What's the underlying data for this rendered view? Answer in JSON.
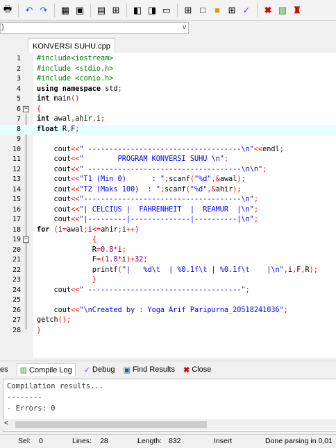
{
  "editor_tab": {
    "filename": "KONVERSI SUHU.cpp"
  },
  "combo": {
    "lead": ")",
    "arrow": "v"
  },
  "code_lines": [
    {
      "n": "1",
      "fold": "",
      "tokens": [
        {
          "c": "pp",
          "t": "#include<iostream>"
        }
      ]
    },
    {
      "n": "2",
      "fold": "",
      "tokens": [
        {
          "c": "pp",
          "t": "#include <stdio.h>"
        }
      ]
    },
    {
      "n": "3",
      "fold": "",
      "tokens": [
        {
          "c": "pp",
          "t": "#include <conio.h>"
        }
      ]
    },
    {
      "n": "4",
      "fold": "",
      "tokens": [
        {
          "c": "kw",
          "t": "using namespace "
        },
        {
          "c": "id",
          "t": "std"
        },
        {
          "c": "sym",
          "t": ";"
        }
      ]
    },
    {
      "n": "5",
      "fold": "",
      "tokens": [
        {
          "c": "kw",
          "t": "int "
        },
        {
          "c": "id",
          "t": "main"
        },
        {
          "c": "sym",
          "t": "()"
        }
      ]
    },
    {
      "n": "6",
      "fold": "⊟",
      "tokens": [
        {
          "c": "sym",
          "t": "{"
        }
      ]
    },
    {
      "n": "7",
      "fold": "",
      "tokens": [
        {
          "c": "kw",
          "t": "int "
        },
        {
          "c": "id",
          "t": "awal"
        },
        {
          "c": "sym",
          "t": ","
        },
        {
          "c": "id",
          "t": "ahir"
        },
        {
          "c": "sym",
          "t": ","
        },
        {
          "c": "id",
          "t": "i"
        },
        {
          "c": "sym",
          "t": ";"
        }
      ]
    },
    {
      "n": "8",
      "fold": "",
      "hl": true,
      "tokens": [
        {
          "c": "kw",
          "t": "float "
        },
        {
          "c": "id",
          "t": "R"
        },
        {
          "c": "sym",
          "t": ","
        },
        {
          "c": "id",
          "t": "F"
        },
        {
          "c": "sym",
          "t": ";"
        }
      ]
    },
    {
      "n": "9",
      "fold": "",
      "tokens": []
    },
    {
      "n": "10",
      "fold": "",
      "tokens": [
        {
          "c": "id",
          "t": "    cout"
        },
        {
          "c": "sym",
          "t": "<<"
        },
        {
          "c": "str",
          "t": "\" ------------------------------------\\n\""
        },
        {
          "c": "sym",
          "t": "<<"
        },
        {
          "c": "id",
          "t": "endl"
        },
        {
          "c": "sym",
          "t": ";"
        }
      ]
    },
    {
      "n": "11",
      "fold": "",
      "tokens": [
        {
          "c": "id",
          "t": "    cout"
        },
        {
          "c": "sym",
          "t": "<<"
        },
        {
          "c": "str",
          "t": "\"        PROGRAM KONVERSI SUHU \\n\""
        },
        {
          "c": "sym",
          "t": ";"
        }
      ]
    },
    {
      "n": "12",
      "fold": "",
      "tokens": [
        {
          "c": "id",
          "t": "    cout"
        },
        {
          "c": "sym",
          "t": "<<"
        },
        {
          "c": "str",
          "t": "\" ------------------------------------\\n\\n\""
        },
        {
          "c": "sym",
          "t": ";"
        }
      ]
    },
    {
      "n": "13",
      "fold": "",
      "tokens": [
        {
          "c": "id",
          "t": "    cout"
        },
        {
          "c": "sym",
          "t": "<<"
        },
        {
          "c": "str",
          "t": "\"T1 (Min 0)      : \""
        },
        {
          "c": "sym",
          "t": ";"
        },
        {
          "c": "id",
          "t": "scanf"
        },
        {
          "c": "sym",
          "t": "("
        },
        {
          "c": "str",
          "t": "\"%d\""
        },
        {
          "c": "sym",
          "t": ",&"
        },
        {
          "c": "id",
          "t": "awal"
        },
        {
          "c": "sym",
          "t": ");"
        }
      ]
    },
    {
      "n": "14",
      "fold": "",
      "tokens": [
        {
          "c": "id",
          "t": "    cout"
        },
        {
          "c": "sym",
          "t": "<<"
        },
        {
          "c": "str",
          "t": "\"T2 (Maks 100)  : \""
        },
        {
          "c": "sym",
          "t": ";"
        },
        {
          "c": "id",
          "t": "scanf"
        },
        {
          "c": "sym",
          "t": "("
        },
        {
          "c": "str",
          "t": "\"%d\""
        },
        {
          "c": "sym",
          "t": ",&"
        },
        {
          "c": "id",
          "t": "ahir"
        },
        {
          "c": "sym",
          "t": ");"
        }
      ]
    },
    {
      "n": "15",
      "fold": "",
      "tokens": [
        {
          "c": "id",
          "t": "    cout"
        },
        {
          "c": "sym",
          "t": "<<"
        },
        {
          "c": "str",
          "t": "\"-------------------------------------\\n\""
        },
        {
          "c": "sym",
          "t": ";"
        }
      ]
    },
    {
      "n": "16",
      "fold": "",
      "tokens": [
        {
          "c": "id",
          "t": "    cout"
        },
        {
          "c": "sym",
          "t": "<<"
        },
        {
          "c": "str",
          "t": "\"| CELCIUS |  FAHRENHEIT  |  REAMUR  |\\n\""
        },
        {
          "c": "sym",
          "t": ";"
        }
      ]
    },
    {
      "n": "17",
      "fold": "",
      "tokens": [
        {
          "c": "id",
          "t": "    cout"
        },
        {
          "c": "sym",
          "t": "<<"
        },
        {
          "c": "str",
          "t": "\"|---------|--------------|----------|\\n\""
        },
        {
          "c": "sym",
          "t": ";"
        }
      ]
    },
    {
      "n": "18",
      "fold": "",
      "tokens": [
        {
          "c": "kw",
          "t": "for "
        },
        {
          "c": "sym",
          "t": "("
        },
        {
          "c": "id",
          "t": "i"
        },
        {
          "c": "sym",
          "t": "="
        },
        {
          "c": "id",
          "t": "awal"
        },
        {
          "c": "sym",
          "t": ";"
        },
        {
          "c": "id",
          "t": "i"
        },
        {
          "c": "sym",
          "t": "<="
        },
        {
          "c": "id",
          "t": "ahir"
        },
        {
          "c": "sym",
          "t": ";"
        },
        {
          "c": "id",
          "t": "i"
        },
        {
          "c": "sym",
          "t": "++)"
        }
      ]
    },
    {
      "n": "19",
      "fold": "⊟",
      "tokens": [
        {
          "c": "sym",
          "t": "             {"
        }
      ]
    },
    {
      "n": "20",
      "fold": "",
      "tokens": [
        {
          "c": "id",
          "t": "             R"
        },
        {
          "c": "sym",
          "t": "="
        },
        {
          "c": "num",
          "t": "0.8"
        },
        {
          "c": "sym",
          "t": "*"
        },
        {
          "c": "id",
          "t": "i"
        },
        {
          "c": "sym",
          "t": ";"
        }
      ]
    },
    {
      "n": "21",
      "fold": "",
      "tokens": [
        {
          "c": "id",
          "t": "             F"
        },
        {
          "c": "sym",
          "t": "=("
        },
        {
          "c": "num",
          "t": "1.8"
        },
        {
          "c": "sym",
          "t": "*"
        },
        {
          "c": "id",
          "t": "i"
        },
        {
          "c": "sym",
          "t": ")+"
        },
        {
          "c": "num",
          "t": "32"
        },
        {
          "c": "sym",
          "t": ";"
        }
      ]
    },
    {
      "n": "22",
      "fold": "",
      "tokens": [
        {
          "c": "id",
          "t": "             printf"
        },
        {
          "c": "sym",
          "t": "("
        },
        {
          "c": "str",
          "t": "\"|   %d\\t  | %0.1f\\t | %0.1f\\t    |\\n\""
        },
        {
          "c": "sym",
          "t": ","
        },
        {
          "c": "id",
          "t": "i"
        },
        {
          "c": "sym",
          "t": ","
        },
        {
          "c": "id",
          "t": "F"
        },
        {
          "c": "sym",
          "t": ","
        },
        {
          "c": "id",
          "t": "R"
        },
        {
          "c": "sym",
          "t": ");"
        }
      ]
    },
    {
      "n": "23",
      "fold": "",
      "tokens": [
        {
          "c": "sym",
          "t": "             }"
        }
      ]
    },
    {
      "n": "24",
      "fold": "",
      "tokens": [
        {
          "c": "id",
          "t": "    cout"
        },
        {
          "c": "sym",
          "t": "<<"
        },
        {
          "c": "str",
          "t": "\" ------------------------------------\""
        },
        {
          "c": "sym",
          "t": ";"
        }
      ]
    },
    {
      "n": "25",
      "fold": "",
      "tokens": []
    },
    {
      "n": "26",
      "fold": "",
      "tokens": [
        {
          "c": "id",
          "t": "    cout"
        },
        {
          "c": "sym",
          "t": "<<"
        },
        {
          "c": "str",
          "t": "\"\\nCreated by : Yoga Arif Paripurna_20518241036\""
        },
        {
          "c": "sym",
          "t": ";"
        }
      ]
    },
    {
      "n": "27",
      "fold": "",
      "tokens": [
        {
          "c": "id",
          "t": "getch"
        },
        {
          "c": "sym",
          "t": "();"
        }
      ]
    },
    {
      "n": "28",
      "fold": "",
      "tokens": [
        {
          "c": "sym",
          "t": "}"
        }
      ]
    }
  ],
  "bottom_tabs": [
    {
      "label": "es",
      "icon": "resources-icon"
    },
    {
      "label": "Compile Log",
      "icon": "compile-log-icon",
      "active": true
    },
    {
      "label": "Debug",
      "icon": "debug-icon"
    },
    {
      "label": "Find Results",
      "icon": "find-results-icon"
    },
    {
      "label": "Close",
      "icon": "close-icon"
    }
  ],
  "log": {
    "lines": [
      "Compilation results...",
      "--------",
      "- Errors: 0"
    ],
    "scroll_arrow": "<"
  },
  "status": {
    "sel_label": "Sel:",
    "sel_value": "0",
    "lines_label": "Lines:",
    "lines_value": "28",
    "length_label": "Length:",
    "length_value": "832",
    "mode": "Insert",
    "message": "Done parsing in 0,01"
  },
  "toolbar_icons": [
    "print-icon",
    "undo-icon",
    "redo-icon",
    "compile-icon",
    "run-icon",
    "compile-run-icon",
    "rebuild-icon",
    "debug-icon",
    "stop-icon",
    "indent-icon",
    "unindent-icon",
    "toggle-comment-icon",
    "grid-icon",
    "window-icon",
    "color-icon",
    "layout-icon",
    "check-icon",
    "close-red-icon",
    "chart-icon",
    "profile-icon"
  ]
}
